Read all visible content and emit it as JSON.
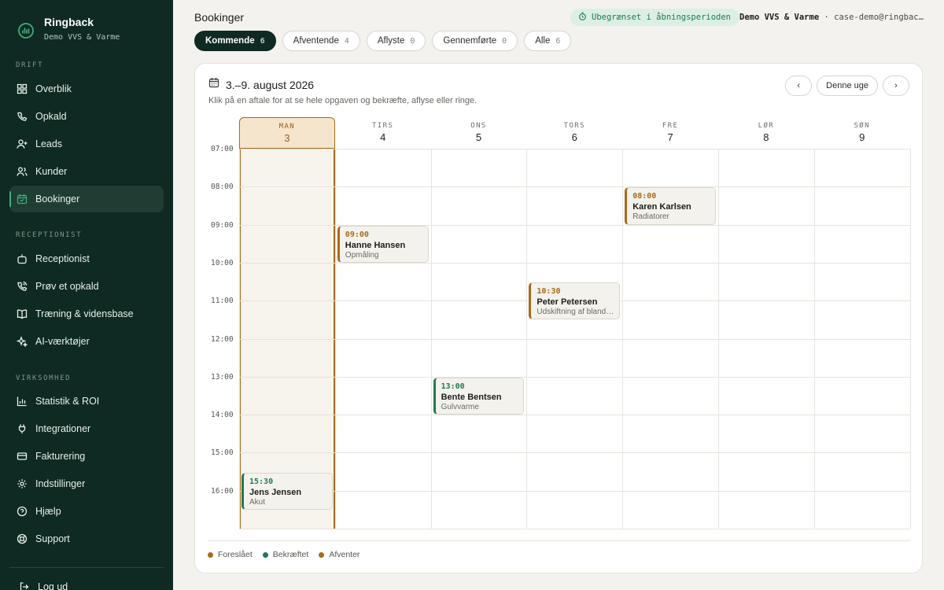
{
  "brand": {
    "name": "Ringback",
    "subtitle": "Demo VVS & Varme"
  },
  "sidebar": {
    "sections": [
      "DRIFT",
      "RECEPTIONIST",
      "VIRKSOMHED"
    ],
    "items": [
      {
        "label": "Overblik",
        "icon": "grid-icon"
      },
      {
        "label": "Opkald",
        "icon": "phone-icon"
      },
      {
        "label": "Leads",
        "icon": "user-plus-icon"
      },
      {
        "label": "Kunder",
        "icon": "users-icon"
      },
      {
        "label": "Bookinger",
        "icon": "calendar-icon"
      },
      {
        "label": "Receptionist",
        "icon": "robot-icon"
      },
      {
        "label": "Prøv et opkald",
        "icon": "phone-call-icon"
      },
      {
        "label": "Træning & vidensbase",
        "icon": "book-icon"
      },
      {
        "label": "AI-værktøjer",
        "icon": "sparkles-icon"
      },
      {
        "label": "Statistik & ROI",
        "icon": "bar-chart-icon"
      },
      {
        "label": "Integrationer",
        "icon": "plug-icon"
      },
      {
        "label": "Fakturering",
        "icon": "credit-card-icon"
      },
      {
        "label": "Indstillinger",
        "icon": "gear-icon"
      },
      {
        "label": "Hjælp",
        "icon": "help-icon"
      },
      {
        "label": "Support",
        "icon": "lifebuoy-icon"
      }
    ],
    "logout": "Log ud"
  },
  "header": {
    "title": "Bookinger",
    "promo": "Ubegrænset i åbningsperioden",
    "company": "Demo VVS & Varme",
    "separator": "·",
    "email": "case-demo@ringback.dk"
  },
  "filters": [
    {
      "label": "Kommende",
      "count": "6"
    },
    {
      "label": "Afventende",
      "count": "4"
    },
    {
      "label": "Aflyste",
      "count": "0"
    },
    {
      "label": "Gennemførte",
      "count": "0"
    },
    {
      "label": "Alle",
      "count": "6"
    }
  ],
  "calendar": {
    "title": "3.–9. august 2026",
    "subtitle": "Klik på en aftale for at se hele opgaven og bekræfte, aflyse eller ringe.",
    "today_label": "Denne uge",
    "days": [
      {
        "name": "MAN",
        "date": "3"
      },
      {
        "name": "TIRS",
        "date": "4"
      },
      {
        "name": "ONS",
        "date": "5"
      },
      {
        "name": "TORS",
        "date": "6"
      },
      {
        "name": "FRE",
        "date": "7"
      },
      {
        "name": "LØR",
        "date": "8"
      },
      {
        "name": "SØN",
        "date": "9"
      }
    ],
    "hours": [
      "07:00",
      "08:00",
      "09:00",
      "10:00",
      "11:00",
      "12:00",
      "13:00",
      "14:00",
      "15:00",
      "16:00"
    ],
    "events": [
      {
        "day": 4,
        "time": "08:00",
        "name": "Karen Karlsen",
        "desc": "Radiatorer",
        "status": "pending"
      },
      {
        "day": 1,
        "time": "09:00",
        "name": "Hanne Hansen",
        "desc": "Opmåling",
        "status": "pending"
      },
      {
        "day": 3,
        "time": "10:30",
        "name": "Peter Petersen",
        "desc": "Udskiftning af blandingsbatteri",
        "status": "pending"
      },
      {
        "day": 2,
        "time": "13:00",
        "name": "Bente Bentsen",
        "desc": "Gulvvarme",
        "status": "confirmed"
      },
      {
        "day": 0,
        "time": "15:30",
        "name": "Jens Jensen",
        "desc": "Akut",
        "status": "confirmed"
      }
    ],
    "legend": [
      {
        "label": "Foreslået",
        "color": "#a86a1a"
      },
      {
        "label": "Bekræftet",
        "color": "#1f7a52"
      },
      {
        "label": "Afventer",
        "color": "#a86a1a"
      }
    ]
  },
  "colors": {
    "sidebar_bg": "#0e2a22",
    "accent_green": "#1f7a52",
    "accent_amber": "#a86a1a"
  }
}
